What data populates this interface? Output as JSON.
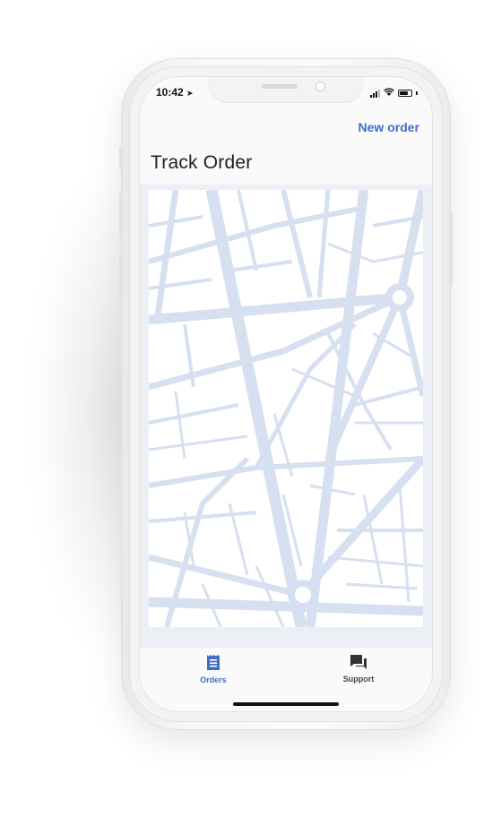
{
  "status_bar": {
    "time": "10:42",
    "location_icon": "location-arrow-icon",
    "signal_icon": "cellular-signal-icon",
    "wifi_icon": "wifi-icon",
    "battery_icon": "battery-icon"
  },
  "header": {
    "action_label": "New order",
    "title": "Track Order"
  },
  "map": {
    "icon": "map-streets"
  },
  "tabbar": {
    "tabs": [
      {
        "label": "Orders",
        "icon": "receipt-icon",
        "active": true
      },
      {
        "label": "Support",
        "icon": "chat-bubbles-icon",
        "active": false
      }
    ]
  },
  "colors": {
    "accent": "#3f6fc5",
    "map_roads": "#d6e0f0",
    "map_background": "#ecf0f6"
  }
}
